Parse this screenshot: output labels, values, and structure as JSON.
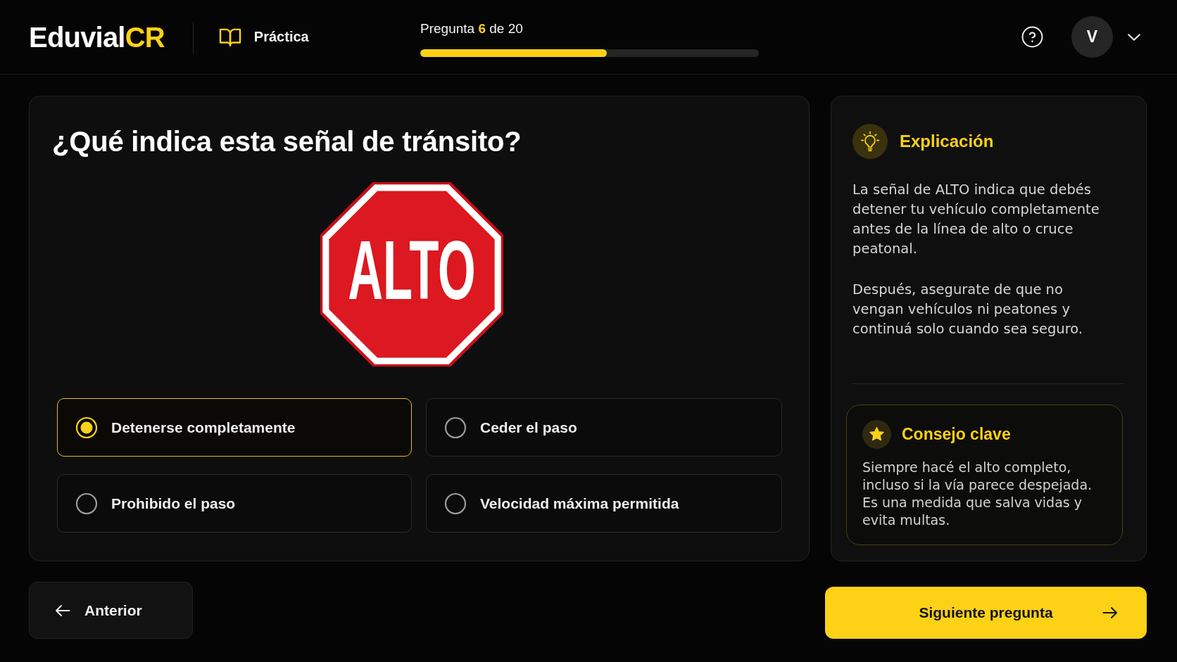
{
  "header": {
    "logo": {
      "text": "Eduvial",
      "accent": "CR"
    },
    "section": "Práctica",
    "progress": {
      "label": "Pregunta **6** de 20",
      "level": 0.55
    },
    "user": {
      "initial": "V"
    }
  },
  "question": {
    "title": "¿Qué indica esta señal de tránsito?",
    "sign": {
      "text": "ALTO"
    },
    "options": [
      {
        "label": "Detenerse completamente",
        "selected": true
      },
      {
        "label": "Ceder el paso",
        "selected": false
      },
      {
        "label": "Prohibido el paso",
        "selected": false
      },
      {
        "label": "Velocidad máxima permitida",
        "selected": false
      }
    ]
  },
  "explanation": {
    "title": "Explicación",
    "paragraphs": [
      "La señal de ALTO indica que debés detener tu vehículo completamente antes de la línea de alto o cruce peatonal.",
      "Después, asegurate de que no vengan vehículos ni peatones y continuá solo cuando sea seguro."
    ],
    "tip": {
      "title": "Consejo clave",
      "text": "Siempre hacé el alto completo, incluso si la vía parece despejada. Es una medida que salva vidas y evita multas."
    }
  },
  "navigation": {
    "previous": "Anterior",
    "next": "Siguiente pregunta"
  }
}
